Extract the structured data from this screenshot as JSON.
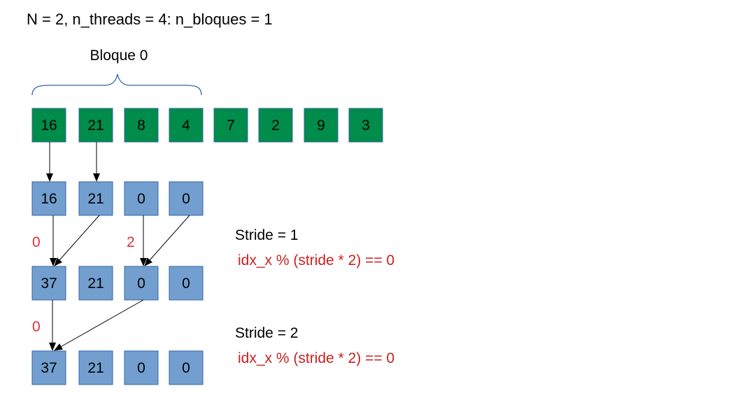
{
  "header": {
    "title": "N = 2, n_threads = 4: n_bloques = 1"
  },
  "block": {
    "label": "Bloque 0"
  },
  "input_array": {
    "values": [
      "16",
      "21",
      "8",
      "4",
      "7",
      "2",
      "9",
      "3"
    ]
  },
  "rows": [
    {
      "values": [
        "16",
        "21",
        "0",
        "0"
      ]
    },
    {
      "values": [
        "37",
        "21",
        "0",
        "0"
      ]
    },
    {
      "values": [
        "37",
        "21",
        "0",
        "0"
      ]
    }
  ],
  "thread_labels": {
    "step1": [
      "0",
      "2"
    ],
    "step2": [
      "0"
    ]
  },
  "annotations": {
    "stride1": {
      "label": "Stride = 1",
      "condition": "idx_x % (stride * 2) == 0"
    },
    "stride2": {
      "label": "Stride = 2",
      "condition": "idx_x % (stride * 2) == 0"
    }
  },
  "colors": {
    "input_fill": "#008C4A",
    "row_fill": "#729FCF",
    "box_stroke": "#3465A4",
    "brace": "#3465A4",
    "thread_label": "#E0303A",
    "condition": "#C9211E",
    "arrow": "#000000",
    "text": "#000000"
  }
}
